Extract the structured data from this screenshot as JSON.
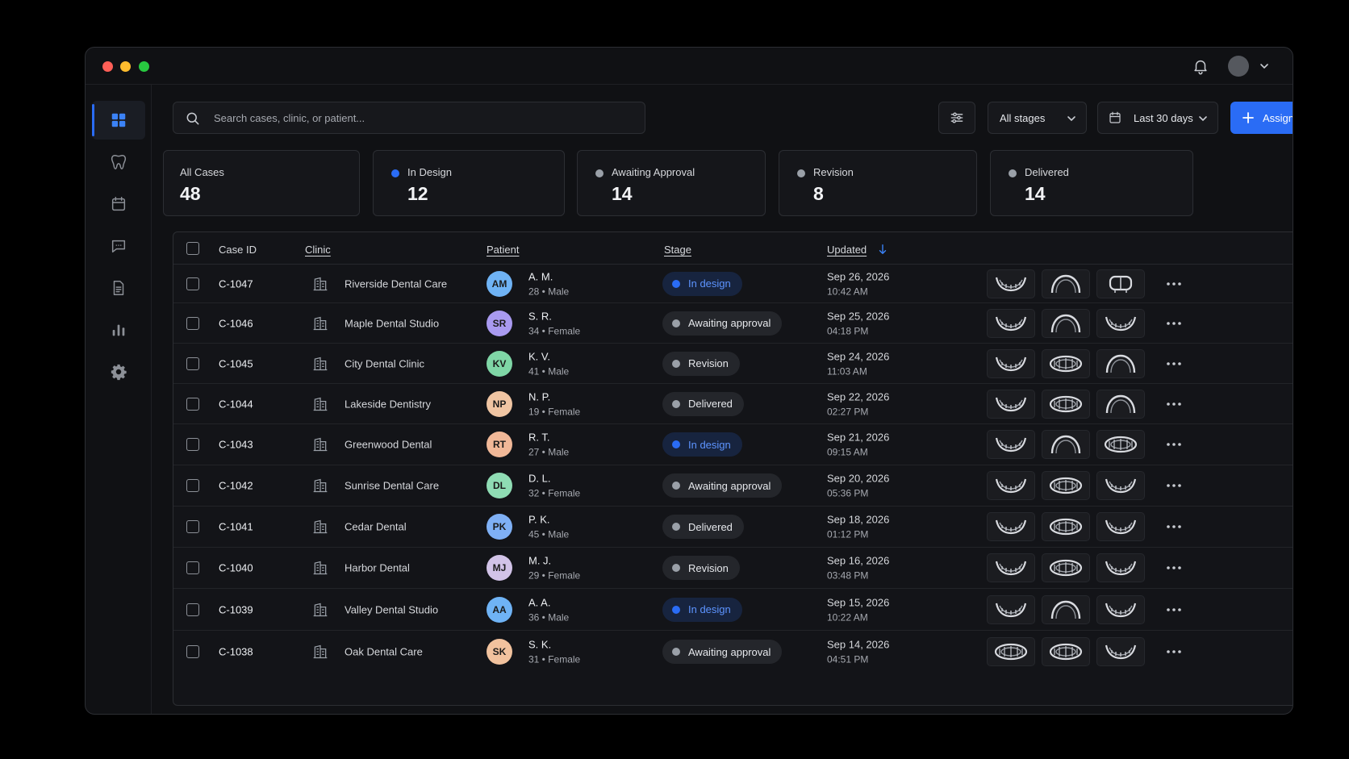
{
  "search": {
    "placeholder": "Search cases, clinic, or patient..."
  },
  "toolbar": {
    "stages_label": "All stages",
    "date_label": "Last 30 days",
    "assign_label": "Assign to planner"
  },
  "colors": {
    "accent": "#2a6cf5",
    "in_design": "#2a6cf5",
    "neutral_status": "#9aa0a8"
  },
  "summary": [
    {
      "label": "All Cases",
      "value": "48",
      "dot": ""
    },
    {
      "label": "In Design",
      "value": "12",
      "dot": "#2a6cf5"
    },
    {
      "label": "Awaiting Approval",
      "value": "14",
      "dot": "#9aa0a8"
    },
    {
      "label": "Revision",
      "value": "8",
      "dot": "#9aa0a8"
    },
    {
      "label": "Delivered",
      "value": "14",
      "dot": "#9aa0a8"
    }
  ],
  "table": {
    "headers": {
      "case_id": "Case ID",
      "clinic": "Clinic",
      "patient": "Patient",
      "stage": "Stage",
      "updated": "Updated"
    },
    "rows": [
      {
        "id": "C-1047",
        "clinic": "Riverside Dental Care",
        "initials": "AM",
        "avatar_color": "#6fb3f5",
        "name": "A. M.",
        "meta": "28 • Male",
        "stage": "In design",
        "stage_type": "in-design",
        "date": "Sep 26, 2026",
        "time": "10:42 AM",
        "thumbs": [
          "lower",
          "upper",
          "molar"
        ]
      },
      {
        "id": "C-1046",
        "clinic": "Maple Dental Studio",
        "initials": "SR",
        "avatar_color": "#a99af0",
        "name": "S. R.",
        "meta": "34 • Female",
        "stage": "Awaiting approval",
        "stage_type": "neutral",
        "date": "Sep 25, 2026",
        "time": "04:18 PM",
        "thumbs": [
          "lower",
          "upper",
          "lower"
        ]
      },
      {
        "id": "C-1045",
        "clinic": "City Dental Clinic",
        "initials": "KV",
        "avatar_color": "#7fd6a6",
        "name": "K. V.",
        "meta": "41 • Male",
        "stage": "Revision",
        "stage_type": "neutral",
        "date": "Sep 24, 2026",
        "time": "11:03 AM",
        "thumbs": [
          "lower",
          "full",
          "upper"
        ]
      },
      {
        "id": "C-1044",
        "clinic": "Lakeside Dentistry",
        "initials": "NP",
        "avatar_color": "#f0c5a3",
        "name": "N. P.",
        "meta": "19 • Female",
        "stage": "Delivered",
        "stage_type": "neutral",
        "date": "Sep 22, 2026",
        "time": "02:27 PM",
        "thumbs": [
          "lower",
          "full",
          "upper"
        ]
      },
      {
        "id": "C-1043",
        "clinic": "Greenwood Dental",
        "initials": "RT",
        "avatar_color": "#f1b898",
        "name": "R. T.",
        "meta": "27 • Male",
        "stage": "In design",
        "stage_type": "in-design",
        "date": "Sep 21, 2026",
        "time": "09:15 AM",
        "thumbs": [
          "lower",
          "upper",
          "full"
        ]
      },
      {
        "id": "C-1042",
        "clinic": "Sunrise Dental Care",
        "initials": "DL",
        "avatar_color": "#8fdcb4",
        "name": "D. L.",
        "meta": "32 • Female",
        "stage": "Awaiting approval",
        "stage_type": "neutral",
        "date": "Sep 20, 2026",
        "time": "05:36 PM",
        "thumbs": [
          "lower",
          "full",
          "lower"
        ]
      },
      {
        "id": "C-1041",
        "clinic": "Cedar Dental",
        "initials": "PK",
        "avatar_color": "#7fb0f5",
        "name": "P. K.",
        "meta": "45 • Male",
        "stage": "Delivered",
        "stage_type": "neutral",
        "date": "Sep 18, 2026",
        "time": "01:12 PM",
        "thumbs": [
          "lower",
          "full",
          "lower"
        ]
      },
      {
        "id": "C-1040",
        "clinic": "Harbor Dental",
        "initials": "MJ",
        "avatar_color": "#d2c3e8",
        "name": "M. J.",
        "meta": "29 • Female",
        "stage": "Revision",
        "stage_type": "neutral",
        "date": "Sep 16, 2026",
        "time": "03:48 PM",
        "thumbs": [
          "lower",
          "full",
          "lower"
        ]
      },
      {
        "id": "C-1039",
        "clinic": "Valley Dental Studio",
        "initials": "AA",
        "avatar_color": "#6fb3f5",
        "name": "A. A.",
        "meta": "36 • Male",
        "stage": "In design",
        "stage_type": "in-design",
        "date": "Sep 15, 2026",
        "time": "10:22 AM",
        "thumbs": [
          "lower",
          "upper",
          "lower"
        ]
      },
      {
        "id": "C-1038",
        "clinic": "Oak Dental Care",
        "initials": "SK",
        "avatar_color": "#f1c29e",
        "name": "S. K.",
        "meta": "31 • Female",
        "stage": "Awaiting approval",
        "stage_type": "neutral",
        "date": "Sep 14, 2026",
        "time": "04:51 PM",
        "thumbs": [
          "full",
          "full",
          "lower"
        ]
      }
    ]
  }
}
